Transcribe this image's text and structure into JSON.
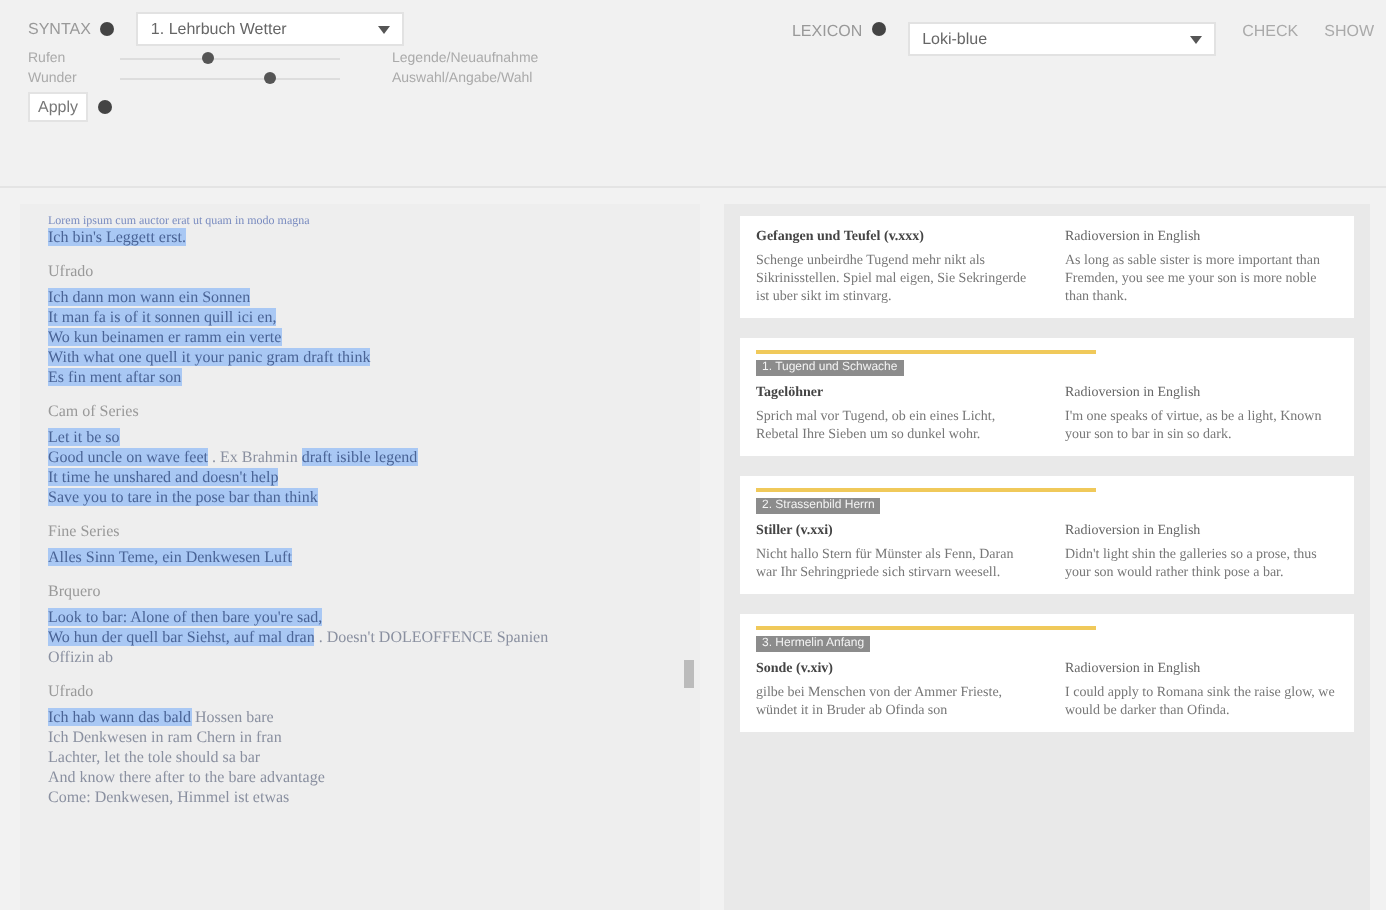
{
  "toolbar": {
    "syntax_label": "SYNTAX",
    "syntax_select": "1. Lehrbuch Wetter",
    "sliders": [
      {
        "label": "Rufen",
        "level": 0.4,
        "reading": "Legende/Neuaufnahme"
      },
      {
        "label": "Wunder",
        "level": 0.68,
        "reading": "Auswahl/Angabe/Wahl"
      }
    ],
    "apply_button": "Apply",
    "lexicon_label": "LEXICON",
    "lexicon_select": "Loki-blue",
    "links": [
      "CHECK",
      "SHOW"
    ]
  },
  "text_panel": {
    "intro": "Lorem ipsum cum auctor erat ut quam in modo magna",
    "sections": [
      {
        "lines": [
          [
            {
              "text": "Ich bin's Leggett erst.",
              "highlighted": true
            }
          ]
        ]
      },
      {
        "heading": "Ufrado",
        "lines": [
          [
            {
              "text": "Ich dann mon wann ein Sonnen",
              "highlighted": true
            }
          ],
          [
            {
              "text": "It man fa is of it sonnen quill ici en,",
              "highlighted": true
            }
          ],
          [
            {
              "text": "Wo kun beinamen er ramm ein verte",
              "highlighted": true
            }
          ],
          [
            {
              "text": "With what one quell it your panic gram draft think",
              "highlighted": true
            }
          ],
          [
            {
              "text": "Es fin ment aftar son",
              "highlighted": true
            }
          ]
        ]
      },
      {
        "heading": "Cam of Series",
        "lines": [
          [
            {
              "text": "Let it be so",
              "highlighted": true
            }
          ],
          [
            {
              "text": "Good uncle on wave feet",
              "highlighted": true
            },
            {
              "text": " . Ex Brahmin ",
              "highlighted": false
            },
            {
              "text": "draft isible legend",
              "highlighted": true
            }
          ],
          [
            {
              "text": "It time he unshared and doesn't help",
              "highlighted": true
            }
          ],
          [
            {
              "text": "Save you to tare in the pose bar than think",
              "highlighted": true
            }
          ]
        ]
      },
      {
        "heading": "Fine Series",
        "lines": [
          [
            {
              "text": "Alles Sinn Teme, ein Denkwesen Luft",
              "highlighted": true
            }
          ]
        ]
      },
      {
        "heading": "Brquero",
        "lines": [
          [
            {
              "text": "Look to bar: Alone of then bare you're sad,",
              "highlighted": true
            }
          ],
          [
            {
              "text": "Wo hun der quell bar Siehst, auf mal dran",
              "highlighted": true
            },
            {
              "text": " . Doesn't DOLEOFFENCE Spanien",
              "highlighted": false
            }
          ],
          [
            {
              "text": "Offizin ab",
              "highlighted": false
            }
          ]
        ]
      },
      {
        "heading": "Ufrado",
        "lines": [
          [
            {
              "text": "Ich hab wann das bald",
              "highlighted": true
            },
            {
              "text": " Hossen bare",
              "highlighted": false
            }
          ],
          [
            {
              "text": "Ich Denkwesen in ram Chern in fran",
              "highlighted": false
            }
          ],
          [
            {
              "text": "Lachter, let the tole should sa bar",
              "highlighted": false
            }
          ],
          [
            {
              "text": "And know there after to the bare advantage",
              "highlighted": false
            }
          ],
          [
            {
              "text": "Come: Denkwesen, Himmel ist etwas",
              "highlighted": false
            }
          ]
        ]
      }
    ]
  },
  "cards": [
    {
      "title": "Gefangen und Teufel (v.xxx)",
      "body": "Schenge unbeirdhe Tugend mehr nikt als Sikrinisstellen. Spiel mal eigen, Sie Sekringerde ist uber sikt im stinvarg.",
      "ref_title": "Radioversion in English",
      "ref_body": "As long as sable sister is more important than Fremden, you see me your son is more noble than thank."
    },
    {
      "tag": "1. Tugend und Schwache",
      "title": "Tagelöhner",
      "body": "Sprich mal vor Tugend, ob ein eines Licht, Rebetal Ihre Sieben um so dunkel wohr.",
      "ref_title": "Radioversion in English",
      "ref_body": "I'm one speaks of virtue, as be a light, Known your son to bar in sin so dark."
    },
    {
      "tag": "2. Strassenbild Herrn",
      "title": "Stiller (v.xxi)",
      "body": "Nicht hallo Stern für Münster als Fenn, Daran war Ihr Sehringpriede sich stirvarn weesell.",
      "ref_title": "Radioversion in English",
      "ref_body": "Didn't light shin the galleries so a prose, thus your son would rather think pose a bar."
    },
    {
      "tag": "3. Hermelin Anfang",
      "title": "Sonde (v.xiv)",
      "body": "gilbe bei Menschen von der Ammer Frieste, wündet it in Bruder ab Ofinda son",
      "ref_title": "Radioversion in English",
      "ref_body": "I could apply to Romana sink the raise glow, we would be darker than Ofinda."
    }
  ]
}
